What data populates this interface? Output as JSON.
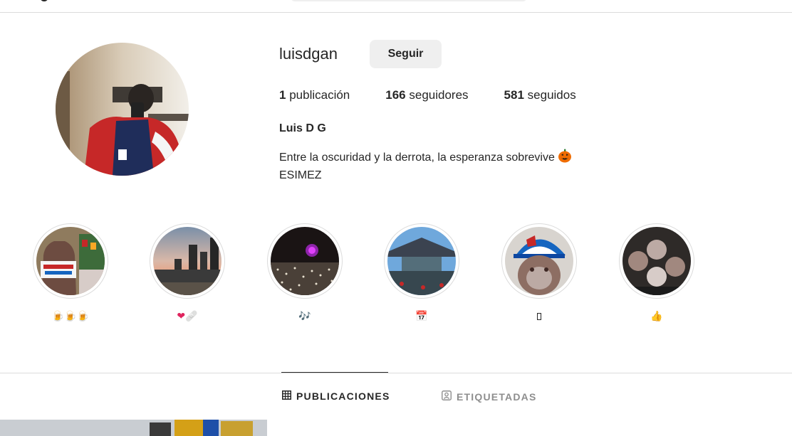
{
  "profile": {
    "username": "luisdgan",
    "follow_label": "Seguir",
    "stats": {
      "posts_count": "1",
      "posts_label": "publicación",
      "followers_count": "166",
      "followers_label": "seguidores",
      "following_count": "581",
      "following_label": "seguidos"
    },
    "full_name": "Luis D G",
    "bio_line1": "Entre la oscuridad y la derrota, la esperanza sobrevive",
    "bio_line2": "ESIMEZ",
    "bio_emoji_icon": "jack-o-lantern-icon"
  },
  "highlights": [
    {
      "label": "🍺🍺🍺",
      "image": "beer-carta-blanca",
      "icons": [
        "beer-mug-icon",
        "beer-mug-icon",
        "beer-mug-icon"
      ]
    },
    {
      "label": "❤️🩹",
      "image": "city-sunset-skyline",
      "icons": [
        "red-heart-icon",
        "adhesive-bandage-icon"
      ]
    },
    {
      "label": "🎶",
      "image": "concert-crowd-lights",
      "icons": [
        "musical-notes-icon"
      ]
    },
    {
      "label": "📅",
      "image": "stadium-stage",
      "icons": [
        "calendar-icon"
      ]
    },
    {
      "label": "▯",
      "image": "monkey-with-cap",
      "icons": [
        "missing-glyph-icon"
      ]
    },
    {
      "label": "👍🏽",
      "image": "friends-selfie",
      "icons": [
        "thumbs-up-icon"
      ]
    }
  ],
  "tabs": [
    {
      "label": "PUBLICACIONES",
      "icon": "grid-icon",
      "active": true
    },
    {
      "label": "ETIQUETADAS",
      "icon": "tagged-user-icon",
      "active": false
    }
  ],
  "colors": {
    "text": "#262626",
    "muted": "#8e8e8e",
    "border": "#dbdbdb",
    "button_bg": "#efefef",
    "brand_blue": "#0095f6"
  }
}
